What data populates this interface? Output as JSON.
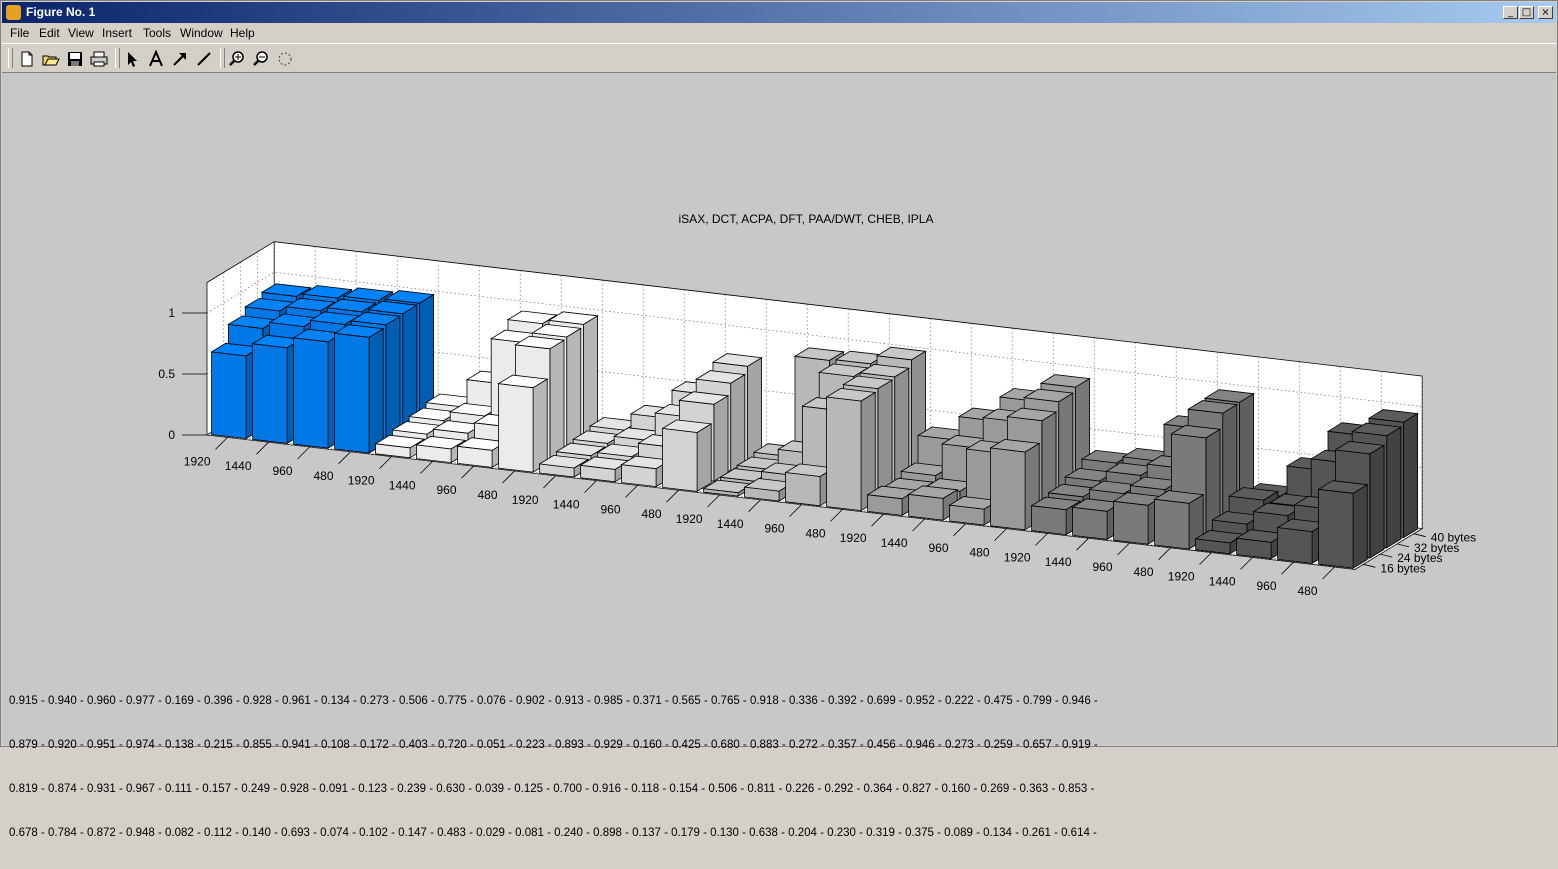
{
  "window": {
    "title": "Figure No. 1",
    "controls": [
      "_",
      "□",
      "×"
    ]
  },
  "menu": [
    "File",
    "Edit",
    "View",
    "Insert",
    "Tools",
    "Window",
    "Help"
  ],
  "toolbar": [
    "new-file-icon",
    "open-folder-icon",
    "save-icon",
    "print-icon",
    "select-arrow-icon",
    "insert-text-icon",
    "insert-arrow-icon",
    "insert-line-icon",
    "zoom-in-icon",
    "zoom-out-icon",
    "rotate-3d-icon"
  ],
  "colors": {
    "isax": "#0078e6",
    "background": "#c8c8c8",
    "titlebar": "#0a246a"
  },
  "chart_data": {
    "type": "bar3d",
    "title": "iSAX, DCT, ACPA, DFT, PAA/DWT, CHEB, IPLA",
    "x_tick_labels": [
      "1920",
      "1440",
      "960",
      "480",
      "1920",
      "1440",
      "960",
      "480",
      "1920",
      "1440",
      "960",
      "480",
      "1920",
      "1440",
      "960",
      "480",
      "1920",
      "1440",
      "960",
      "480",
      "1920",
      "1440",
      "960",
      "480",
      "1920",
      "1440",
      "960",
      "480"
    ],
    "y_tick_labels": [
      "16 bytes",
      "24 bytes",
      "32 bytes",
      "40 bytes"
    ],
    "z_ticks": [
      "0",
      "0.5",
      "1"
    ],
    "zlim": [
      0,
      1.25
    ],
    "grid": true,
    "series": [
      {
        "name": "16 bytes",
        "values": [
          0.678,
          0.784,
          0.872,
          0.948,
          0.082,
          0.112,
          0.14,
          0.693,
          0.074,
          0.102,
          0.147,
          0.483,
          0.029,
          0.081,
          0.24,
          0.898,
          0.137,
          0.179,
          0.13,
          0.638,
          0.204,
          0.23,
          0.319,
          0.375,
          0.089,
          0.134,
          0.261,
          0.614
        ]
      },
      {
        "name": "24 bytes",
        "values": [
          0.819,
          0.874,
          0.931,
          0.967,
          0.111,
          0.157,
          0.249,
          0.928,
          0.091,
          0.123,
          0.239,
          0.63,
          0.039,
          0.125,
          0.7,
          0.916,
          0.118,
          0.154,
          0.506,
          0.811,
          0.226,
          0.292,
          0.364,
          0.827,
          0.16,
          0.269,
          0.363,
          0.853
        ]
      },
      {
        "name": "32 bytes",
        "values": [
          0.879,
          0.92,
          0.951,
          0.974,
          0.138,
          0.215,
          0.855,
          0.941,
          0.108,
          0.172,
          0.403,
          0.72,
          0.051,
          0.223,
          0.893,
          0.929,
          0.16,
          0.425,
          0.68,
          0.883,
          0.272,
          0.357,
          0.456,
          0.946,
          0.273,
          0.259,
          0.657,
          0.919
        ]
      },
      {
        "name": "40 bytes",
        "values": [
          0.915,
          0.94,
          0.96,
          0.977,
          0.169,
          0.396,
          0.928,
          0.961,
          0.134,
          0.273,
          0.506,
          0.775,
          0.076,
          0.902,
          0.913,
          0.985,
          0.371,
          0.565,
          0.765,
          0.918,
          0.336,
          0.392,
          0.699,
          0.952,
          0.222,
          0.475,
          0.799,
          0.946
        ]
      }
    ],
    "group_colors": [
      "#0078e6",
      "#ebebeb",
      "#d3d3d3",
      "#b8b8b8",
      "#9a9a9a",
      "#7a7a7a",
      "#555555"
    ]
  },
  "footer_lines": [
    "0.915 - 0.940 - 0.960 - 0.977 - 0.169 - 0.396 - 0.928 - 0.961 - 0.134 - 0.273 - 0.506 - 0.775 - 0.076 - 0.902 - 0.913 - 0.985 - 0.371 - 0.565 - 0.765 - 0.918 - 0.336 - 0.392 - 0.699 - 0.952 - 0.222 - 0.475 - 0.799 - 0.946 -",
    "0.879 - 0.920 - 0.951 - 0.974 - 0.138 - 0.215 - 0.855 - 0.941 - 0.108 - 0.172 - 0.403 - 0.720 - 0.051 - 0.223 - 0.893 - 0.929 - 0.160 - 0.425 - 0.680 - 0.883 - 0.272 - 0.357 - 0.456 - 0.946 - 0.273 - 0.259 - 0.657 - 0.919 -",
    "0.819 - 0.874 - 0.931 - 0.967 - 0.111 - 0.157 - 0.249 - 0.928 - 0.091 - 0.123 - 0.239 - 0.630 - 0.039 - 0.125 - 0.700 - 0.916 - 0.118 - 0.154 - 0.506 - 0.811 - 0.226 - 0.292 - 0.364 - 0.827 - 0.160 - 0.269 - 0.363 - 0.853 -",
    "0.678 - 0.784 - 0.872 - 0.948 - 0.082 - 0.112 - 0.140 - 0.693 - 0.074 - 0.102 - 0.147 - 0.483 - 0.029 - 0.081 - 0.240 - 0.898 - 0.137 - 0.179 - 0.130 - 0.638 - 0.204 - 0.230 - 0.319 - 0.375 - 0.089 - 0.134 - 0.261 - 0.614 -"
  ]
}
